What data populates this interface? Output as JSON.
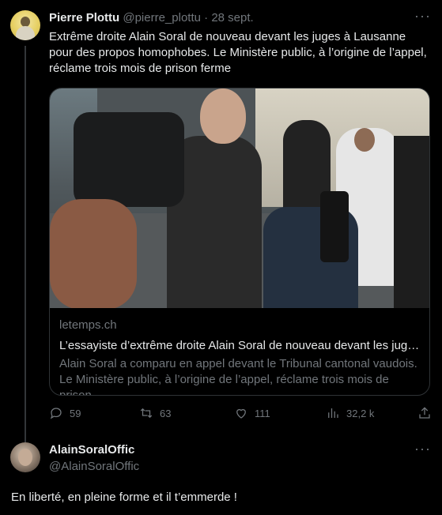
{
  "tweet": {
    "author_name": "Pierre Plottu",
    "author_handle": "@pierre_plottu",
    "separator": "·",
    "date": "28 sept.",
    "text": "Extrême droite Alain Soral de nouveau devant les juges à Lausanne pour des propos homophobes. Le Ministère public, à l’origine de l’appel, réclame trois mois de prison ferme",
    "more_label": "···",
    "card": {
      "domain": "letemps.ch",
      "title": "L’essayiste d’extrême droite Alain Soral de nouveau devant les juges à...",
      "description": "Alain Soral a comparu en appel devant le Tribunal cantonal vaudois. Le Ministère public, à l’origine de l’appel, réclame trois mois de prison ..."
    },
    "actions": {
      "replies": "59",
      "retweets": "63",
      "likes": "111",
      "views": "32,2 k"
    },
    "icons": {
      "reply": "comment-icon",
      "retweet": "retweet-icon",
      "like": "heart-icon",
      "views": "analytics-icon",
      "share": "share-icon"
    }
  },
  "reply": {
    "author_name": "AlainSoralOffic",
    "author_handle": "@AlainSoralOffic",
    "more_label": "···",
    "text": "En liberté, en pleine forme et il t’emmerde !"
  },
  "colors": {
    "background": "#000000",
    "text": "#e7e9ea",
    "muted": "#71767b",
    "border": "#2f3336"
  }
}
